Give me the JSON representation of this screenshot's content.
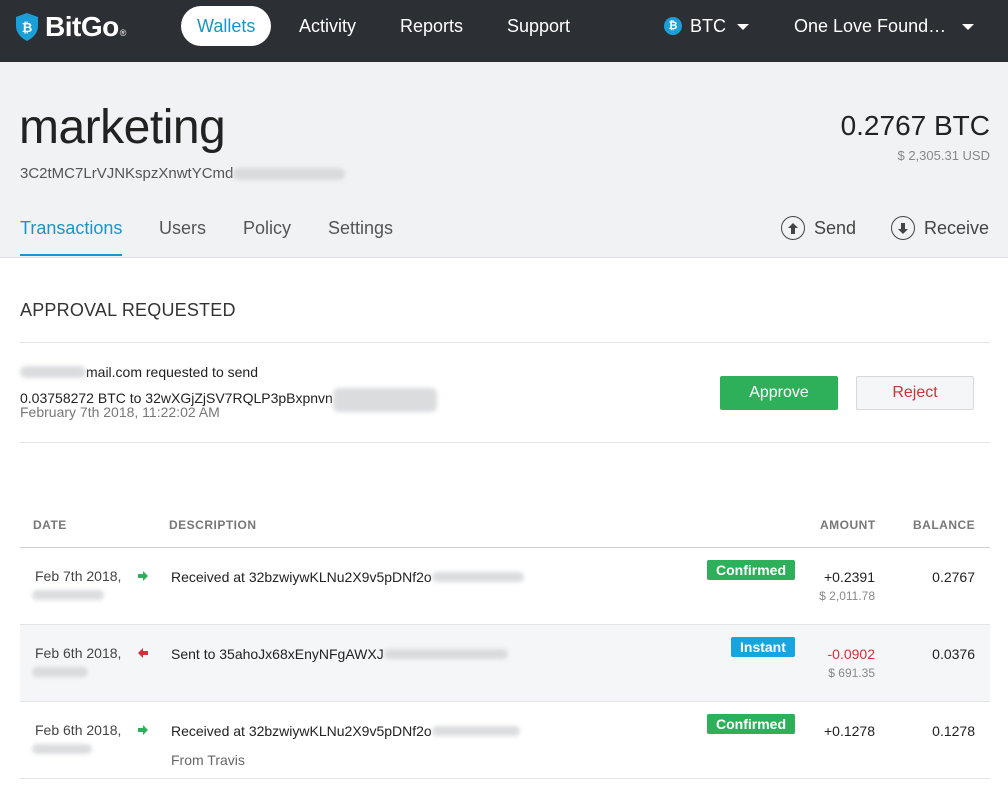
{
  "nav": {
    "logo": "BitGo",
    "logo_mark": "®",
    "items": [
      {
        "label": "Wallets",
        "active": true
      },
      {
        "label": "Activity"
      },
      {
        "label": "Reports"
      },
      {
        "label": "Support"
      }
    ],
    "coin": {
      "label": "BTC",
      "icon": "bitcoin-icon"
    },
    "organization": "One Love Found…"
  },
  "wallet": {
    "name": "marketing",
    "address": "3C2tMC7LrVJNKspzXnwtYCmd",
    "balance": "0.2767 BTC",
    "balance_usd": "$ 2,305.31 USD"
  },
  "tabs": [
    {
      "label": "Transactions",
      "active": true
    },
    {
      "label": "Users"
    },
    {
      "label": "Policy"
    },
    {
      "label": "Settings"
    }
  ],
  "actions": {
    "send": "Send",
    "receive": "Receive"
  },
  "approval": {
    "title": "APPROVAL REQUESTED",
    "requester_suffix": "mail.com requested to send",
    "amount_line": "0.03758272 BTC to 32wXGjZjSV7RQLP3pBxpnvn",
    "date": "February 7th 2018, 11:22:02 AM",
    "approve_label": "Approve",
    "reject_label": "Reject"
  },
  "table": {
    "columns": {
      "date": "DATE",
      "description": "DESCRIPTION",
      "amount": "AMOUNT",
      "balance": "BALANCE"
    },
    "rows": [
      {
        "date": "Feb 7th 2018,",
        "direction": "in",
        "description": "Received at 32bzwiywKLNu2X9v5pDNf2o",
        "status": "Confirmed",
        "amount": "+0.2391",
        "amount_usd": "$ 2,011.78",
        "balance": "0.2767"
      },
      {
        "date": "Feb 6th 2018,",
        "direction": "out",
        "description": "Sent to 35ahoJx68xEnyNFgAWXJ",
        "status": "Instant",
        "amount": "-0.0902",
        "amount_usd": "$ 691.35",
        "balance": "0.0376"
      },
      {
        "date": "Feb 6th 2018,",
        "direction": "in",
        "description": "Received at 32bzwiywKLNu2X9v5pDNf2o",
        "sub_description": "From Travis",
        "status": "Confirmed",
        "amount": "+0.1278",
        "balance": "0.1278"
      }
    ]
  },
  "colors": {
    "topbar": "#2c2f33",
    "accent": "#1a95c9",
    "confirmed": "#2eb05a",
    "instant": "#17a4e0",
    "negative": "#d0333a",
    "incoming_arrow": "#2eb05a",
    "outgoing_arrow": "#d0333a"
  }
}
